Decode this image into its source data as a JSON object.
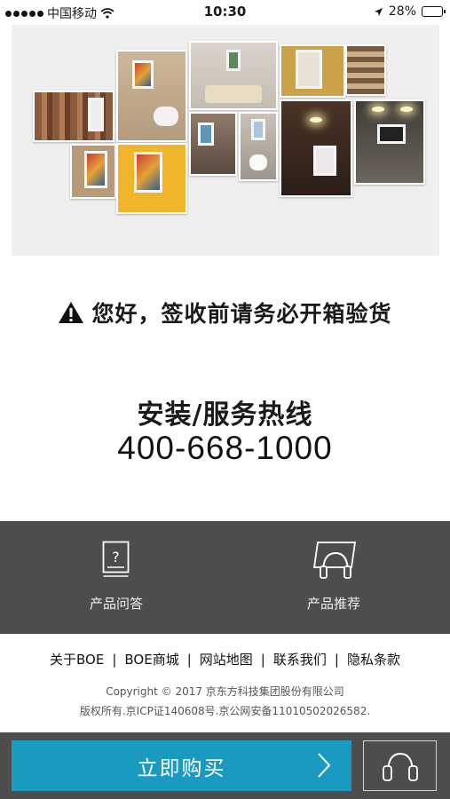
{
  "status_bar": {
    "carrier": "中国移动",
    "time": "10:30",
    "battery": "28%",
    "battery_level": 0.28,
    "icons": [
      "signal-dots-icon",
      "wifi-icon",
      "location-arrow-icon",
      "battery-icon"
    ]
  },
  "warning": {
    "icon": "warning-triangle-icon",
    "text": "您好，签收前请务必开箱验货"
  },
  "hotline": {
    "title": "安装/服务热线",
    "number": "400-668-1000"
  },
  "service": {
    "qa_label": "产品问答",
    "qa_icon": "document-question-icon",
    "recommend_label": "产品推荐",
    "recommend_icon": "headphones-screen-icon"
  },
  "footer": {
    "links": [
      "关于BOE",
      "BOE商城",
      "网站地图",
      "联系我们",
      "隐私条款"
    ],
    "copyright_line1": "Copyright © 2017 京东方科技集团股份有限公司",
    "copyright_line2": "版权所有.京ICP证140608号.京公网安备11010502026582."
  },
  "bottom": {
    "buy_label": "立即购买",
    "buy_icon": "chevron-right-icon",
    "support_icon": "headset-icon"
  },
  "colors": {
    "buy_button": "#1a9ac1",
    "dark_bar": "#4d4d4d"
  }
}
